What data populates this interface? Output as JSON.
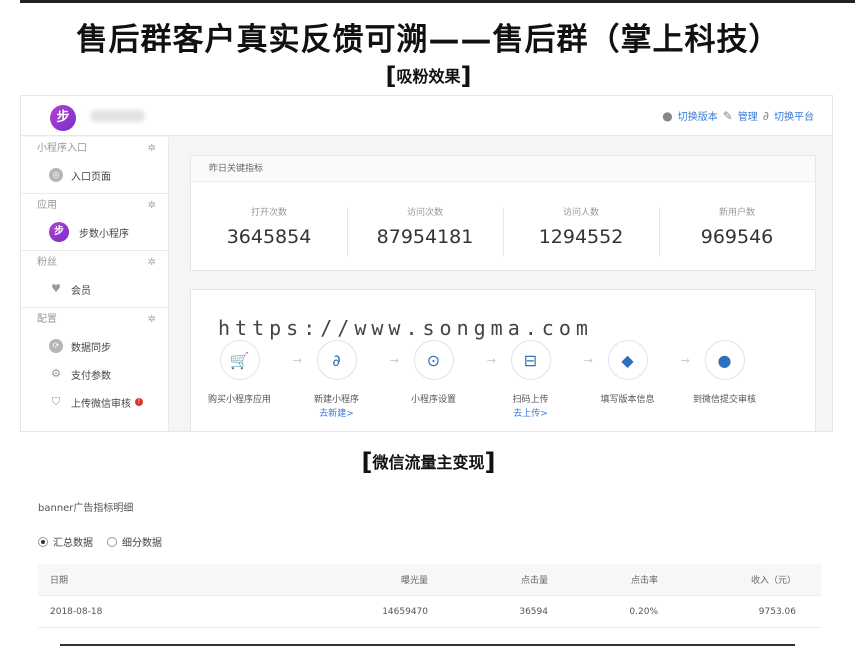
{
  "headline": "售后群客户真实反馈可溯——售后群（掌上科技）",
  "section1_label": "吸粉效果",
  "section2_label": "微信流量主变现",
  "brackets": {
    "open": "[",
    "close": "]"
  },
  "admin": {
    "logo_char": "步",
    "header_actions": [
      {
        "icon": "circle-icon",
        "label": "切换版本"
      },
      {
        "icon": "pencil-icon",
        "label": "管理"
      },
      {
        "icon": "link-icon",
        "label": "切换平台"
      }
    ],
    "sidebar": {
      "groups": [
        {
          "title": "小程序入口",
          "items": [
            {
              "icon": "page-icon",
              "label": "入口页面"
            }
          ]
        },
        {
          "title": "应用",
          "items": [
            {
              "icon": "mini-program-icon",
              "label": "步数小程序"
            }
          ]
        },
        {
          "title": "粉丝",
          "items": [
            {
              "icon": "heart-icon",
              "label": "会员"
            }
          ]
        },
        {
          "title": "配置",
          "items": [
            {
              "icon": "sync-icon",
              "label": "数据同步"
            },
            {
              "icon": "gear-icon",
              "label": "支付参数"
            },
            {
              "icon": "shield-icon",
              "label": "上传微信审核",
              "badge": "!"
            }
          ]
        }
      ]
    },
    "metrics": {
      "title": "昨日关键指标",
      "items": [
        {
          "label": "打开次数",
          "value": "3645854"
        },
        {
          "label": "访问次数",
          "value": "87954181"
        },
        {
          "label": "访问人数",
          "value": "1294552"
        },
        {
          "label": "新用户数",
          "value": "969546"
        }
      ]
    },
    "watermark": "https://www.songma.com",
    "steps": [
      {
        "icon": "cart-icon",
        "label": "购买小程序应用",
        "sub": ""
      },
      {
        "icon": "mini-program-icon",
        "label": "新建小程序",
        "sub": "去新建>"
      },
      {
        "icon": "settings-icon",
        "label": "小程序设置",
        "sub": ""
      },
      {
        "icon": "scan-icon",
        "label": "扫码上传",
        "sub": "去上传>"
      },
      {
        "icon": "layers-icon",
        "label": "填写版本信息",
        "sub": ""
      },
      {
        "icon": "wechat-icon",
        "label": "到微信提交审核",
        "sub": ""
      }
    ]
  },
  "banner": {
    "title": "banner广告指标明细",
    "radios": [
      {
        "label": "汇总数据",
        "checked": true
      },
      {
        "label": "细分数据",
        "checked": false
      }
    ],
    "columns": [
      "日期",
      "曝光量",
      "点击量",
      "点击率",
      "收入（元）"
    ],
    "rows": [
      [
        "2018-08-18",
        "14659470",
        "36594",
        "0.20%",
        "9753.06"
      ]
    ]
  }
}
